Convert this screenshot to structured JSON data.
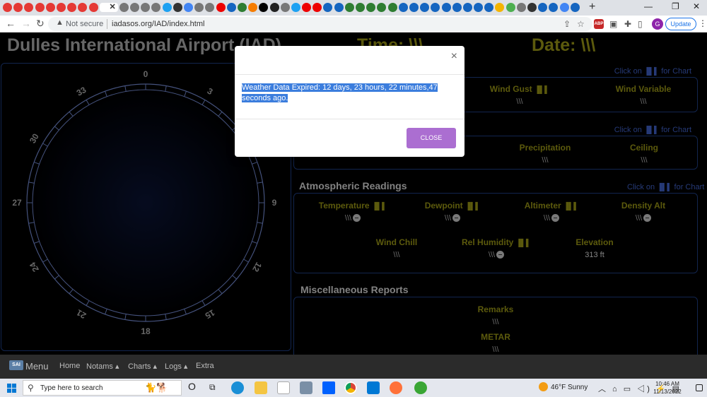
{
  "browser": {
    "address": {
      "security_label": "Not secure",
      "url": "iadasos.org/IAD/index.html"
    },
    "update_label": "Update",
    "profile_initial": "G",
    "abp_label": "ABP"
  },
  "header": {
    "title": "Dulles International Airport (IAD)",
    "time_label": "Time: \\\\\\",
    "date_label": "Date: \\\\\\"
  },
  "compass": {
    "labels": [
      "0",
      "3",
      "9",
      "12",
      "15",
      "18",
      "21",
      "24",
      "27",
      "30",
      "33"
    ]
  },
  "wind_section": {
    "chart_link": "Click on",
    "chart_link_suffix": "for Chart",
    "fields": [
      {
        "label": "Wind Gust",
        "value": "\\\\\\"
      },
      {
        "label": "Wind Variable",
        "value": "\\\\\\"
      }
    ]
  },
  "visibility_section": {
    "chart_link": "Click on",
    "chart_link_suffix": "for Chart",
    "fields": [
      {
        "label": "Precipitation",
        "value": "\\\\\\"
      },
      {
        "label": "Ceiling",
        "value": "\\\\\\"
      }
    ]
  },
  "atmospheric": {
    "title": "Atmospheric Readings",
    "chart_link": "Click on",
    "chart_link_suffix": "for Chart",
    "row1": [
      {
        "label": "Temperature",
        "value": "\\\\\\"
      },
      {
        "label": "Dewpoint",
        "value": "\\\\\\"
      },
      {
        "label": "Altimeter",
        "value": "\\\\\\"
      },
      {
        "label": "Density Alt",
        "value": "\\\\\\"
      }
    ],
    "row2": [
      {
        "label": "Wind Chill",
        "value": "\\\\\\"
      },
      {
        "label": "Rel Humidity",
        "value": "\\\\\\"
      },
      {
        "label": "Elevation",
        "value": "313 ft"
      }
    ]
  },
  "misc": {
    "title": "Miscellaneous Reports",
    "fields": [
      {
        "label": "Remarks",
        "value": "\\\\\\"
      },
      {
        "label": "METAR",
        "value": "\\\\\\"
      }
    ]
  },
  "modal": {
    "message": "Weather Data Expired: 12 days, 23 hours, 22 minutes,47 seconds ago.",
    "close_label": "CLOSE",
    "close_x": "×"
  },
  "bottom_nav": {
    "logo": "SAI",
    "menu": "Menu",
    "items": [
      "Home",
      "Notams ▴",
      "Charts ▴",
      "Logs ▴",
      "Extra"
    ]
  },
  "taskbar": {
    "search_placeholder": "Type here to search",
    "weather": "46°F  Sunny",
    "time": "10:46 AM",
    "date": "11/13/2022"
  },
  "colors": {
    "accent_yellow": "#8e8b14",
    "panel_border": "#1c3a7a",
    "modal_button": "#ab6ed1",
    "selection": "#3b7ddd"
  }
}
